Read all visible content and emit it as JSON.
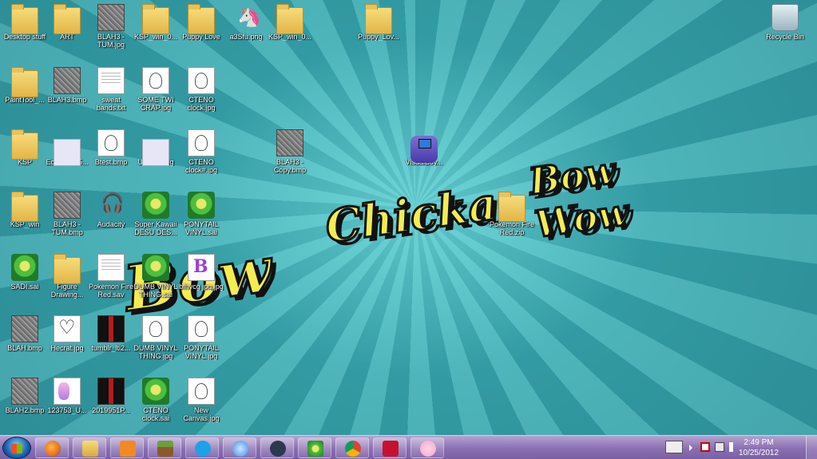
{
  "desktop_icons": [
    {
      "label": "Desktop stuff"
    },
    {
      "label": "ART"
    },
    {
      "label": "BLAH3 - TUM.jpg"
    },
    {
      "label": "KSP_win_0..."
    },
    {
      "label": "Puppy Love"
    },
    {
      "label": "a3Sfu.png"
    },
    {
      "label": "KSP_win_0..."
    },
    {
      "label": "Puppy_Lov..."
    },
    {
      "label": "Recycle Bin"
    },
    {
      "label": "PaintTool_..."
    },
    {
      "label": "BLAH3.bmp"
    },
    {
      "label": "sweat bands.txt"
    },
    {
      "label": "SOME TWI CRAP.jpg"
    },
    {
      "label": "CTENO clock.jpg"
    },
    {
      "label": "KSP"
    },
    {
      "label": "Echo13495..."
    },
    {
      "label": "Btest.bmp"
    },
    {
      "label": "Untitled.jpg"
    },
    {
      "label": "CTENO clock#.jpg"
    },
    {
      "label": "BLAH3 - Copy.bmp"
    },
    {
      "label": "VisualBoy..."
    },
    {
      "label": "KSP_win"
    },
    {
      "label": "BLAH3 - TUM.bmp"
    },
    {
      "label": "Audacity"
    },
    {
      "label": "Super Kawaii DESU DES..."
    },
    {
      "label": "PONYTAIL VINYL.sai"
    },
    {
      "label": "Pokemon Fire Red.zip"
    },
    {
      "label": "SADI.sai"
    },
    {
      "label": "Figure Drawing..."
    },
    {
      "label": "Pokemon Fire Red.sav"
    },
    {
      "label": "DUMB VINYL THING.sai"
    },
    {
      "label": "bfhycg jpg.jpg"
    },
    {
      "label": "BLAH.bmp"
    },
    {
      "label": "Hecrat.jpg"
    },
    {
      "label": "tumblr_lti2..."
    },
    {
      "label": "DUMB VINYL THING.jpg"
    },
    {
      "label": "PONYTAIL VINYL.jpg"
    },
    {
      "label": "BLAH2.bmp"
    },
    {
      "label": "123753_U..."
    },
    {
      "label": "2019951P..."
    },
    {
      "label": "CTENO clock.sai"
    },
    {
      "label": "New Canvas.jpg"
    }
  ],
  "wallpaper": {
    "line1": "Bow",
    "line2": "Chicka",
    "line3": "Bow Wow",
    "colors": {
      "ray_dark": "#37a5ad",
      "ray_light": "#55c3c8",
      "text": "#f5ec52"
    }
  },
  "taskbar": {
    "pinned": [
      {
        "name": "firefox-icon",
        "color": "#e8731a"
      },
      {
        "name": "explorer-icon",
        "color": "#f2cd5a"
      },
      {
        "name": "media-player-icon",
        "color": "#f08a24"
      },
      {
        "name": "minecraft-icon",
        "color": "#5b8a34"
      },
      {
        "name": "skype-icon",
        "color": "#1ea1e6"
      },
      {
        "name": "itunes-icon",
        "color": "#3a8ee6"
      },
      {
        "name": "steam-icon",
        "color": "#2a3a4c"
      },
      {
        "name": "paint-tool-sai-icon",
        "color": "#4cbf3c"
      },
      {
        "name": "chrome-icon",
        "color": "#db4437"
      },
      {
        "name": "acrobat-icon",
        "color": "#c8102e"
      },
      {
        "name": "anime-app-icon",
        "color": "#f3a6c8"
      }
    ],
    "clock": {
      "time": "2:49 PM",
      "date": "10/25/2012"
    }
  }
}
